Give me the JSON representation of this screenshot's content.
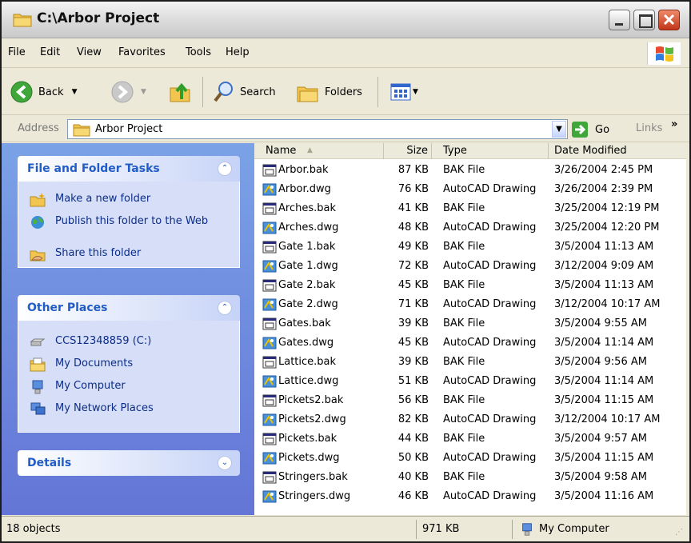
{
  "window": {
    "title": "C:\\Arbor Project"
  },
  "menu": [
    "File",
    "Edit",
    "View",
    "Favorites",
    "Tools",
    "Help"
  ],
  "toolbar": {
    "back": "Back",
    "search": "Search",
    "folders": "Folders"
  },
  "address": {
    "label": "Address",
    "value": "Arbor Project",
    "go": "Go",
    "links": "Links"
  },
  "tasks": {
    "file_folder": {
      "title": "File and Folder Tasks",
      "items": [
        {
          "label": "Make a new folder",
          "icon": "new-folder-icon"
        },
        {
          "label": "Publish this folder to the Web",
          "icon": "publish-web-icon"
        },
        {
          "label": "Share this folder",
          "icon": "share-folder-icon"
        }
      ]
    },
    "other_places": {
      "title": "Other Places",
      "items": [
        {
          "label": "CCS12348859 (C:)",
          "icon": "drive-icon"
        },
        {
          "label": "My Documents",
          "icon": "my-documents-icon"
        },
        {
          "label": "My Computer",
          "icon": "my-computer-icon"
        },
        {
          "label": "My Network Places",
          "icon": "network-places-icon"
        }
      ]
    },
    "details": {
      "title": "Details"
    }
  },
  "columns": {
    "name": "Name",
    "size": "Size",
    "type": "Type",
    "date": "Date Modified"
  },
  "files": [
    {
      "name": "Arbor.bak",
      "size": "87 KB",
      "type": "BAK File",
      "date": "3/26/2004 2:45 PM"
    },
    {
      "name": "Arbor.dwg",
      "size": "76 KB",
      "type": "AutoCAD Drawing",
      "date": "3/26/2004 2:39 PM"
    },
    {
      "name": "Arches.bak",
      "size": "41 KB",
      "type": "BAK File",
      "date": "3/25/2004 12:19 PM"
    },
    {
      "name": "Arches.dwg",
      "size": "48 KB",
      "type": "AutoCAD Drawing",
      "date": "3/25/2004 12:20 PM"
    },
    {
      "name": "Gate 1.bak",
      "size": "49 KB",
      "type": "BAK File",
      "date": "3/5/2004 11:13 AM"
    },
    {
      "name": "Gate 1.dwg",
      "size": "72 KB",
      "type": "AutoCAD Drawing",
      "date": "3/12/2004 9:09 AM"
    },
    {
      "name": "Gate 2.bak",
      "size": "45 KB",
      "type": "BAK File",
      "date": "3/5/2004 11:13 AM"
    },
    {
      "name": "Gate 2.dwg",
      "size": "71 KB",
      "type": "AutoCAD Drawing",
      "date": "3/12/2004 10:17 AM"
    },
    {
      "name": "Gates.bak",
      "size": "39 KB",
      "type": "BAK File",
      "date": "3/5/2004 9:55 AM"
    },
    {
      "name": "Gates.dwg",
      "size": "45 KB",
      "type": "AutoCAD Drawing",
      "date": "3/5/2004 11:14 AM"
    },
    {
      "name": "Lattice.bak",
      "size": "39 KB",
      "type": "BAK File",
      "date": "3/5/2004 9:56 AM"
    },
    {
      "name": "Lattice.dwg",
      "size": "51 KB",
      "type": "AutoCAD Drawing",
      "date": "3/5/2004 11:14 AM"
    },
    {
      "name": "Pickets2.bak",
      "size": "56 KB",
      "type": "BAK File",
      "date": "3/5/2004 11:15 AM"
    },
    {
      "name": "Pickets2.dwg",
      "size": "82 KB",
      "type": "AutoCAD Drawing",
      "date": "3/12/2004 10:17 AM"
    },
    {
      "name": "Pickets.bak",
      "size": "44 KB",
      "type": "BAK File",
      "date": "3/5/2004 9:57 AM"
    },
    {
      "name": "Pickets.dwg",
      "size": "50 KB",
      "type": "AutoCAD Drawing",
      "date": "3/5/2004 11:15 AM"
    },
    {
      "name": "Stringers.bak",
      "size": "40 KB",
      "type": "BAK File",
      "date": "3/5/2004 9:58 AM"
    },
    {
      "name": "Stringers.dwg",
      "size": "46 KB",
      "type": "AutoCAD Drawing",
      "date": "3/5/2004 11:16 AM"
    }
  ],
  "status": {
    "count": "18 objects",
    "size": "971 KB",
    "location": "My Computer"
  }
}
